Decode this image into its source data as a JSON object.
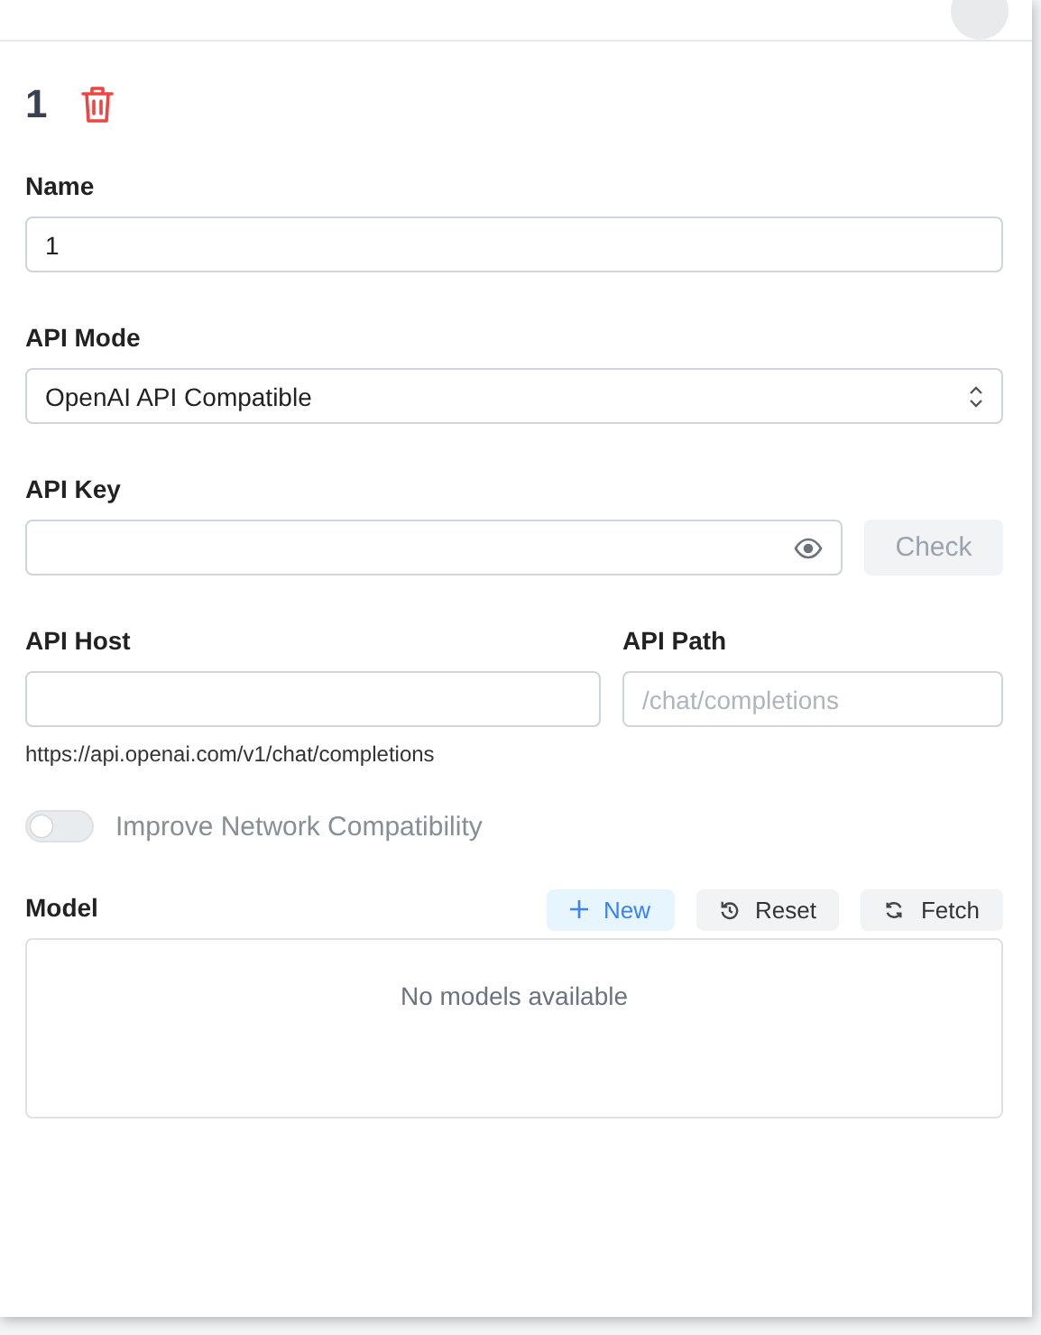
{
  "provider": {
    "name": "1"
  },
  "fields": [
    {
      "kind": "text",
      "label": "Name",
      "value": "1"
    },
    {
      "kind": "select",
      "label": "API Mode",
      "value": "OpenAI API Compatible"
    },
    {
      "kind": "secret",
      "label": "API Key",
      "button": {
        "label": "Check",
        "disabled": true
      }
    }
  ],
  "host": {
    "label": "API Host",
    "hint": "https://api.openai.com/v1/chat/completions"
  },
  "path": {
    "label": "API Path",
    "placeholder": "/chat/completions"
  },
  "toggle": {
    "label": "Improve Network Compatibility",
    "on": false
  },
  "models": {
    "label": "Model",
    "actions": [
      {
        "kind": "new",
        "label": "New"
      },
      {
        "kind": "reset",
        "label": "Reset"
      },
      {
        "kind": "fetch",
        "label": "Fetch"
      }
    ],
    "empty": "No models available"
  }
}
